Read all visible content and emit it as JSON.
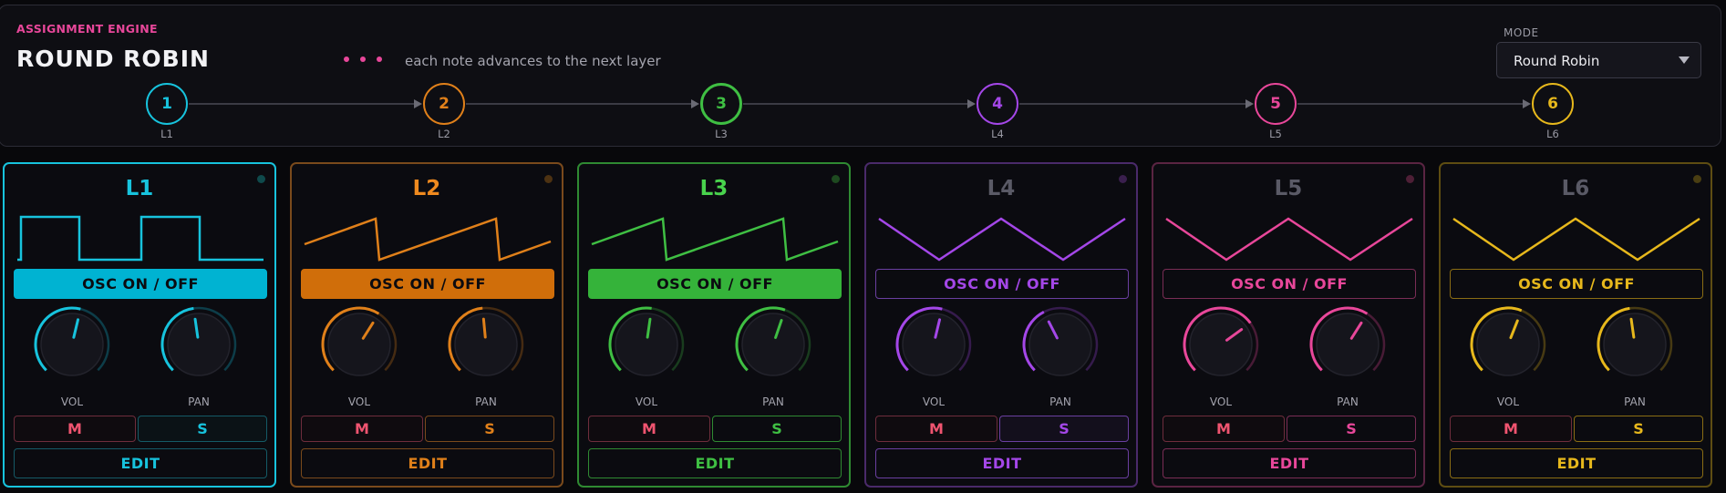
{
  "engine": {
    "label": "ASSIGNMENT ENGINE",
    "title": "ROUND ROBIN",
    "description": "each note advances to the next layer",
    "mode_label": "MODE",
    "mode_value": "Round Robin"
  },
  "flow": [
    {
      "num": "1",
      "sub": "L1",
      "color": "#17c3dd",
      "active": false
    },
    {
      "num": "2",
      "sub": "L2",
      "color": "#e0801a",
      "active": false
    },
    {
      "num": "3",
      "sub": "L3",
      "color": "#3fbf43",
      "active": true
    },
    {
      "num": "4",
      "sub": "L4",
      "color": "#a447e8",
      "active": false
    },
    {
      "num": "5",
      "sub": "L5",
      "color": "#e8479a",
      "active": false
    },
    {
      "num": "6",
      "sub": "L6",
      "color": "#e7b81c",
      "active": false
    }
  ],
  "layers": [
    {
      "name": "L1",
      "color": "#17c3dd",
      "title_color": "#17c3dd",
      "border": "#17c3dd",
      "led": "#0f4a4c",
      "wave": "square",
      "osc": "OSC ON / OFF",
      "osc_on": true,
      "osc_bg": "#00b3d2",
      "vol": 0.55,
      "pan": 0.47,
      "vol_label": "VOL",
      "pan_label": "PAN",
      "m": "M",
      "s": "S",
      "edit": "EDIT",
      "s_border": "#155a66",
      "s_bg": "#0b1216",
      "edit_border": "#155a66"
    },
    {
      "name": "L2",
      "color": "#e0801a",
      "title_color": "#ef8a1f",
      "border": "#7a4a1c",
      "led": "#4d3212",
      "wave": "saw",
      "osc": "OSC ON / OFF",
      "osc_on": true,
      "osc_bg": "#d06e0a",
      "vol": 0.62,
      "pan": 0.48,
      "vol_label": "VOL",
      "pan_label": "PAN",
      "m": "M",
      "s": "S",
      "edit": "EDIT",
      "s_border": "#7a4a1c",
      "s_bg": "#0b0b10",
      "edit_border": "#7a4a1c"
    },
    {
      "name": "L3",
      "color": "#3fbf43",
      "title_color": "#49d34d",
      "border": "#2f8a32",
      "led": "#1e4a20",
      "wave": "saw",
      "osc": "OSC ON / OFF",
      "osc_on": true,
      "osc_bg": "#35b33a",
      "vol": 0.53,
      "pan": 0.57,
      "vol_label": "VOL",
      "pan_label": "PAN",
      "m": "M",
      "s": "S",
      "edit": "EDIT",
      "s_border": "#2f8a32",
      "s_bg": "#0b0b10",
      "edit_border": "#2f8a32"
    },
    {
      "name": "L4",
      "color": "#a447e8",
      "title_color": "#5a5a66",
      "border": "#4a2a6a",
      "led": "#3a1f4e",
      "wave": "triangle",
      "osc": "OSC ON / OFF",
      "osc_on": false,
      "osc_bg": "#0b0b10",
      "vol": 0.55,
      "pan": 0.4,
      "vol_label": "VOL",
      "pan_label": "PAN",
      "m": "M",
      "s": "S",
      "edit": "EDIT",
      "s_border": "#6a3fa0",
      "s_bg": "#130f1c",
      "edit_border": "#6a3fa0"
    },
    {
      "name": "L5",
      "color": "#e8479a",
      "title_color": "#5a5a66",
      "border": "#5a2442",
      "led": "#4e1f36",
      "wave": "triangle",
      "osc": "OSC ON / OFF",
      "osc_on": false,
      "osc_bg": "#0b0b10",
      "vol": 0.7,
      "pan": 0.62,
      "vol_label": "VOL",
      "pan_label": "PAN",
      "m": "M",
      "s": "S",
      "edit": "EDIT",
      "s_border": "#7a2d55",
      "s_bg": "#0b0b10",
      "edit_border": "#7a2d55"
    },
    {
      "name": "L6",
      "color": "#e7b81c",
      "title_color": "#5a5a66",
      "border": "#5e4d12",
      "led": "#4a3e12",
      "wave": "triangle",
      "osc": "OSC ON / OFF",
      "osc_on": false,
      "osc_bg": "#0b0b10",
      "vol": 0.58,
      "pan": 0.47,
      "vol_label": "VOL",
      "pan_label": "PAN",
      "m": "M",
      "s": "S",
      "edit": "EDIT",
      "s_border": "#8a6d14",
      "s_bg": "#0b0b10",
      "edit_border": "#8a6d14"
    }
  ]
}
